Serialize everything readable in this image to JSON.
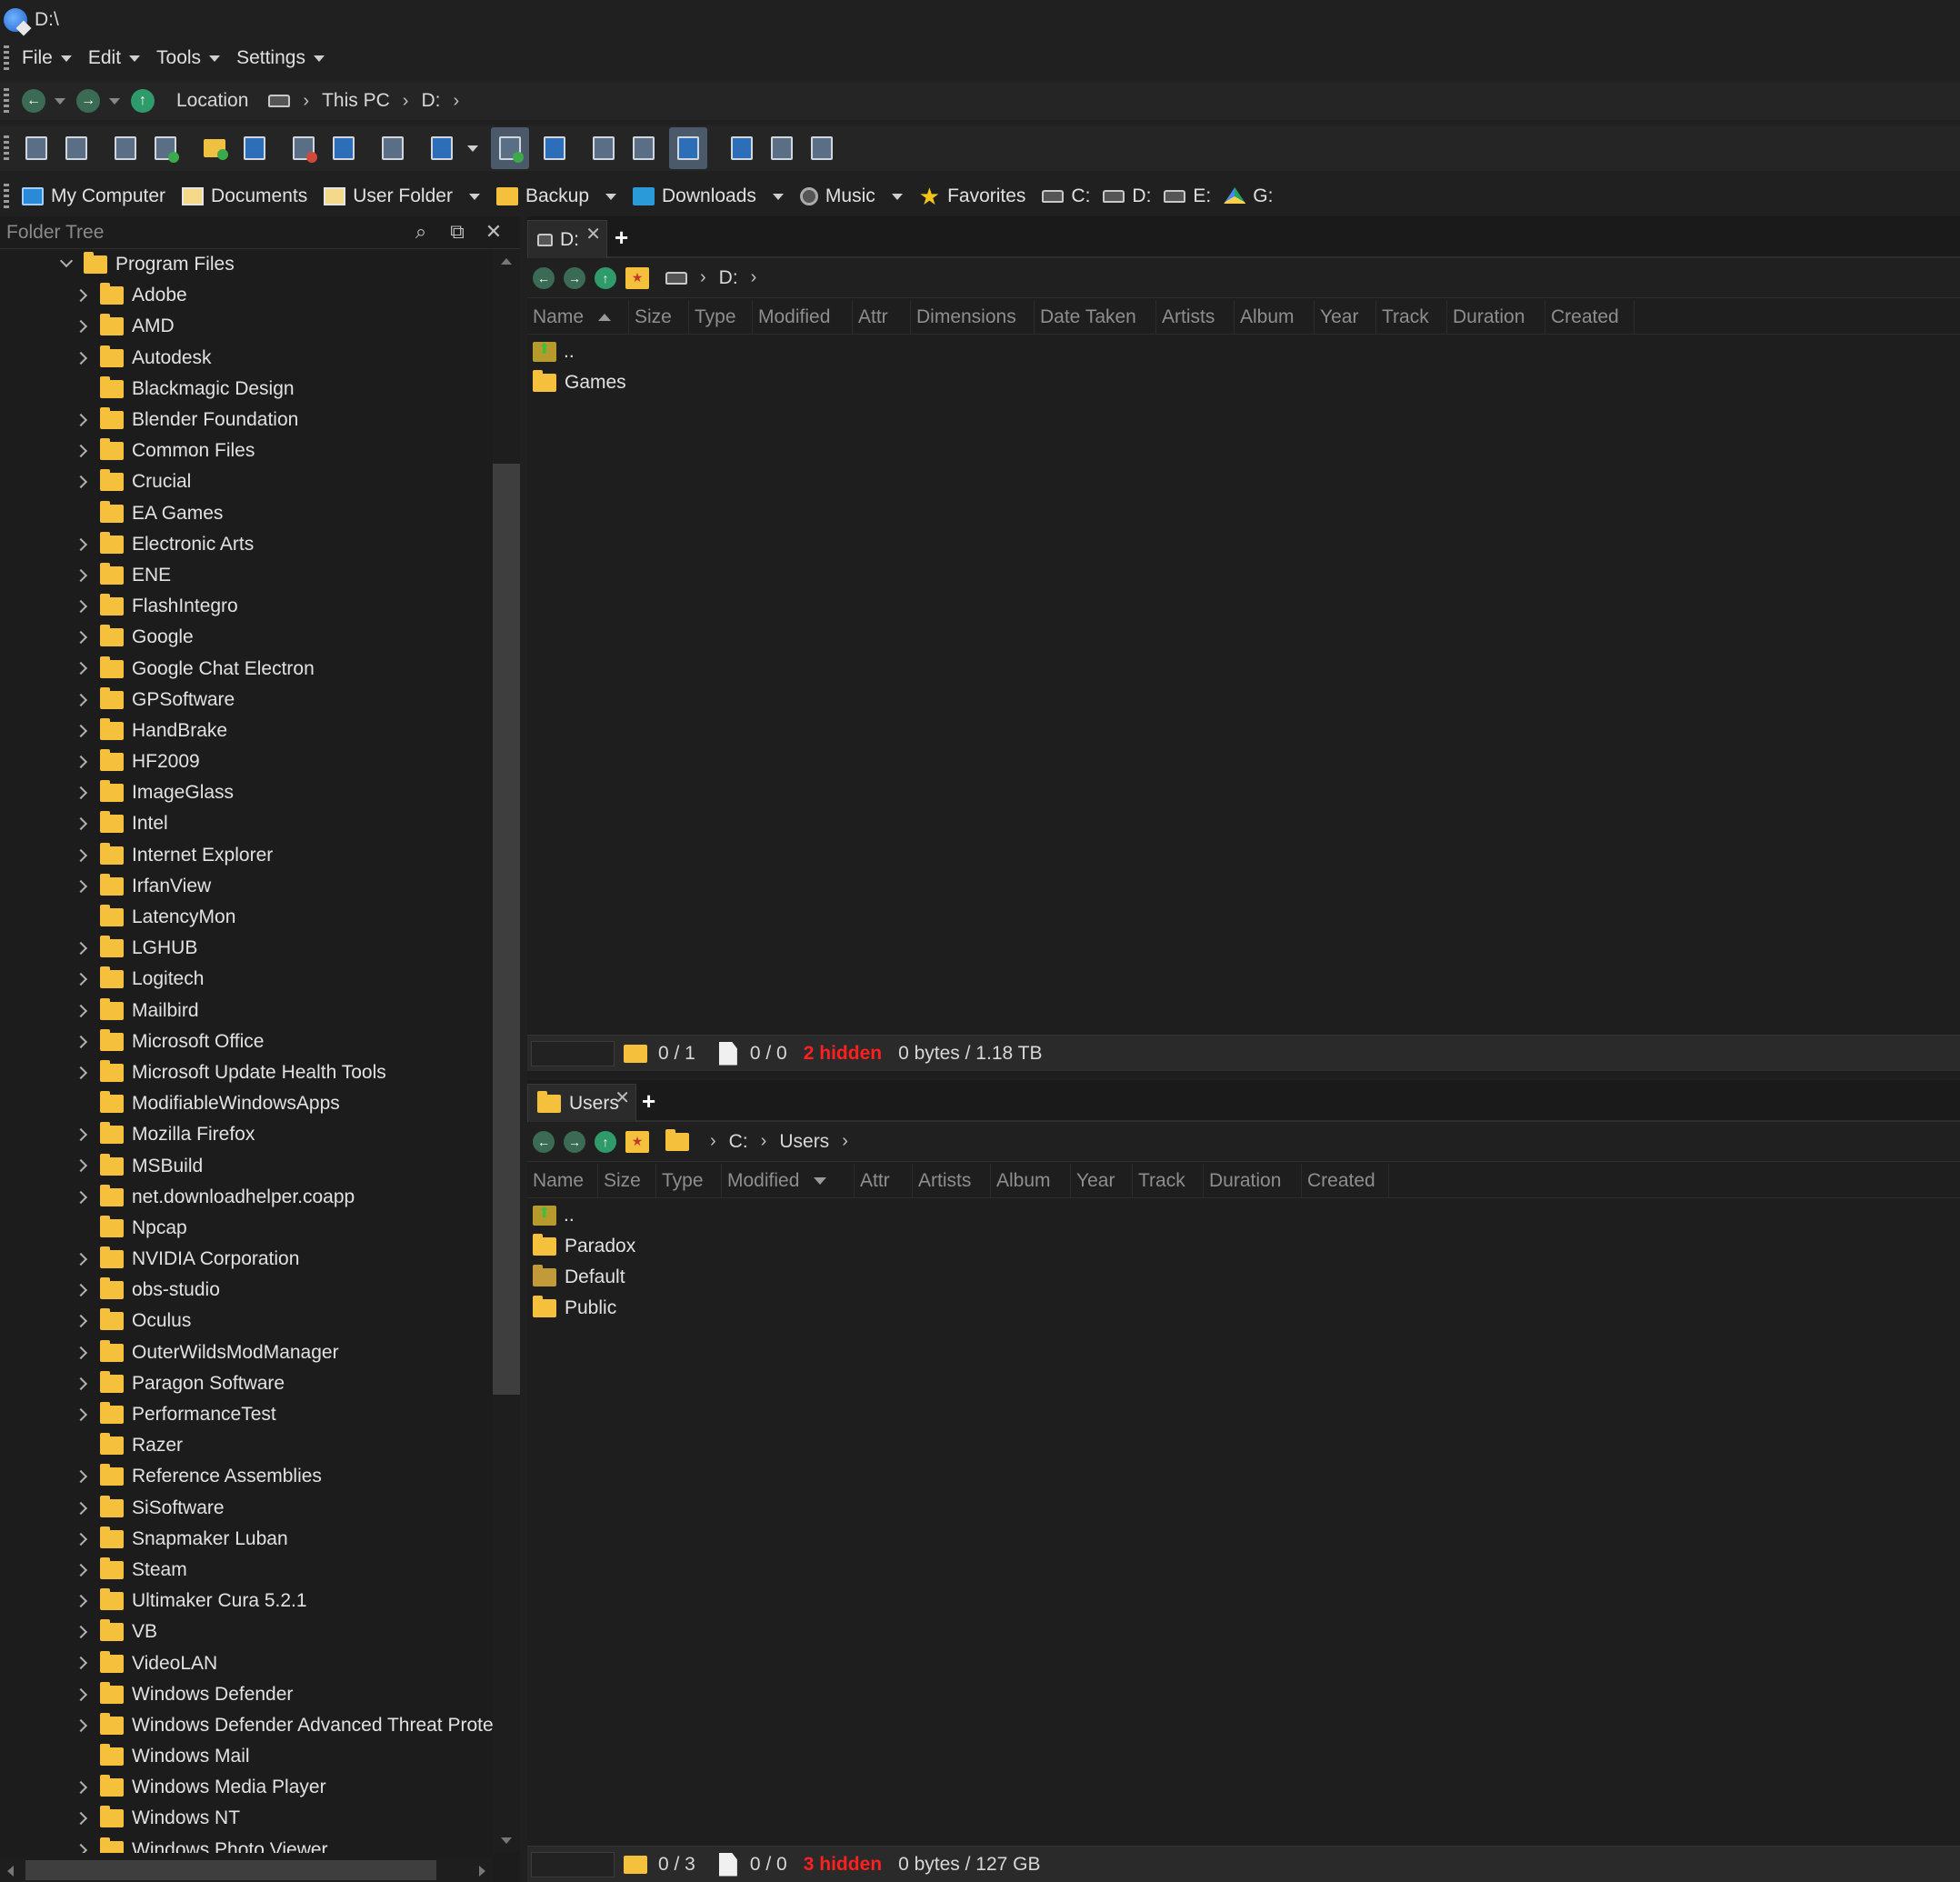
{
  "window": {
    "title": "D:\\"
  },
  "menu": [
    "File",
    "Edit",
    "Tools",
    "Settings"
  ],
  "location_bar": {
    "label": "Location",
    "crumbs": [
      "This PC",
      "D:"
    ]
  },
  "favorites": [
    {
      "label": "My Computer",
      "icon": "computer-icon"
    },
    {
      "label": "Documents",
      "icon": "documents-icon"
    },
    {
      "label": "User Folder",
      "icon": "user-folder-icon"
    },
    {
      "label": "Backup",
      "icon": "folder-icon"
    },
    {
      "label": "Downloads",
      "icon": "downloads-icon"
    },
    {
      "label": "Music",
      "icon": "music-icon"
    },
    {
      "label": "Favorites",
      "icon": "star-icon"
    },
    {
      "label": "C:",
      "icon": "drive-icon"
    },
    {
      "label": "D:",
      "icon": "drive-icon"
    },
    {
      "label": "E:",
      "icon": "drive-icon"
    },
    {
      "label": "G:",
      "icon": "google-drive-icon"
    }
  ],
  "folder_tree": {
    "title": "Folder Tree",
    "root": "Program Files",
    "items": [
      {
        "label": "Adobe",
        "expandable": true
      },
      {
        "label": "AMD",
        "expandable": true
      },
      {
        "label": "Autodesk",
        "expandable": true
      },
      {
        "label": "Blackmagic Design",
        "expandable": false
      },
      {
        "label": "Blender Foundation",
        "expandable": true
      },
      {
        "label": "Common Files",
        "expandable": true
      },
      {
        "label": "Crucial",
        "expandable": true
      },
      {
        "label": "EA Games",
        "expandable": false
      },
      {
        "label": "Electronic Arts",
        "expandable": true
      },
      {
        "label": "ENE",
        "expandable": true
      },
      {
        "label": "FlashIntegro",
        "expandable": true
      },
      {
        "label": "Google",
        "expandable": true
      },
      {
        "label": "Google Chat Electron",
        "expandable": true
      },
      {
        "label": "GPSoftware",
        "expandable": true
      },
      {
        "label": "HandBrake",
        "expandable": true
      },
      {
        "label": "HF2009",
        "expandable": true
      },
      {
        "label": "ImageGlass",
        "expandable": true
      },
      {
        "label": "Intel",
        "expandable": true
      },
      {
        "label": "Internet Explorer",
        "expandable": true
      },
      {
        "label": "IrfanView",
        "expandable": true
      },
      {
        "label": "LatencyMon",
        "expandable": false
      },
      {
        "label": "LGHUB",
        "expandable": true
      },
      {
        "label": "Logitech",
        "expandable": true
      },
      {
        "label": "Mailbird",
        "expandable": true
      },
      {
        "label": "Microsoft Office",
        "expandable": true
      },
      {
        "label": "Microsoft Update Health Tools",
        "expandable": true
      },
      {
        "label": "ModifiableWindowsApps",
        "expandable": false
      },
      {
        "label": "Mozilla Firefox",
        "expandable": true
      },
      {
        "label": "MSBuild",
        "expandable": true
      },
      {
        "label": "net.downloadhelper.coapp",
        "expandable": true
      },
      {
        "label": "Npcap",
        "expandable": false
      },
      {
        "label": "NVIDIA Corporation",
        "expandable": true
      },
      {
        "label": "obs-studio",
        "expandable": true
      },
      {
        "label": "Oculus",
        "expandable": true
      },
      {
        "label": "OuterWildsModManager",
        "expandable": true
      },
      {
        "label": "Paragon Software",
        "expandable": true
      },
      {
        "label": "PerformanceTest",
        "expandable": true
      },
      {
        "label": "Razer",
        "expandable": false
      },
      {
        "label": "Reference Assemblies",
        "expandable": true
      },
      {
        "label": "SiSoftware",
        "expandable": true
      },
      {
        "label": "Snapmaker Luban",
        "expandable": true
      },
      {
        "label": "Steam",
        "expandable": true
      },
      {
        "label": "Ultimaker Cura 5.2.1",
        "expandable": true
      },
      {
        "label": "VB",
        "expandable": true
      },
      {
        "label": "VideoLAN",
        "expandable": true
      },
      {
        "label": "Windows Defender",
        "expandable": true
      },
      {
        "label": "Windows Defender Advanced Threat Protec",
        "expandable": true
      },
      {
        "label": "Windows Mail",
        "expandable": false
      },
      {
        "label": "Windows Media Player",
        "expandable": true
      },
      {
        "label": "Windows NT",
        "expandable": true
      },
      {
        "label": "Windows Photo Viewer",
        "expandable": true
      }
    ]
  },
  "top_pane": {
    "tab": "D:",
    "crumbs": [
      "D:"
    ],
    "columns": [
      "Name",
      "Size",
      "Type",
      "Modified",
      "Attr",
      "Dimensions",
      "Date Taken",
      "Artists",
      "Album",
      "Year",
      "Track",
      "Duration",
      "Created"
    ],
    "files": [
      {
        "name": "..",
        "kind": "up"
      },
      {
        "name": "Games",
        "kind": "folder"
      }
    ],
    "status": {
      "folders": "0 / 1",
      "files": "0 / 0",
      "hidden": "2 hidden",
      "size": "0 bytes / 1.18 TB"
    }
  },
  "bottom_pane": {
    "tab": "Users",
    "crumbs": [
      "C:",
      "Users"
    ],
    "columns": [
      "Name",
      "Size",
      "Type",
      "Modified",
      "Attr",
      "Artists",
      "Album",
      "Year",
      "Track",
      "Duration",
      "Created"
    ],
    "files": [
      {
        "name": "..",
        "kind": "up"
      },
      {
        "name": "Paradox",
        "kind": "folder"
      },
      {
        "name": "Default",
        "kind": "folder-dim"
      },
      {
        "name": "Public",
        "kind": "folder"
      }
    ],
    "status": {
      "folders": "0 / 3",
      "files": "0 / 0",
      "hidden": "3 hidden",
      "size": "0 bytes / 127 GB"
    }
  }
}
